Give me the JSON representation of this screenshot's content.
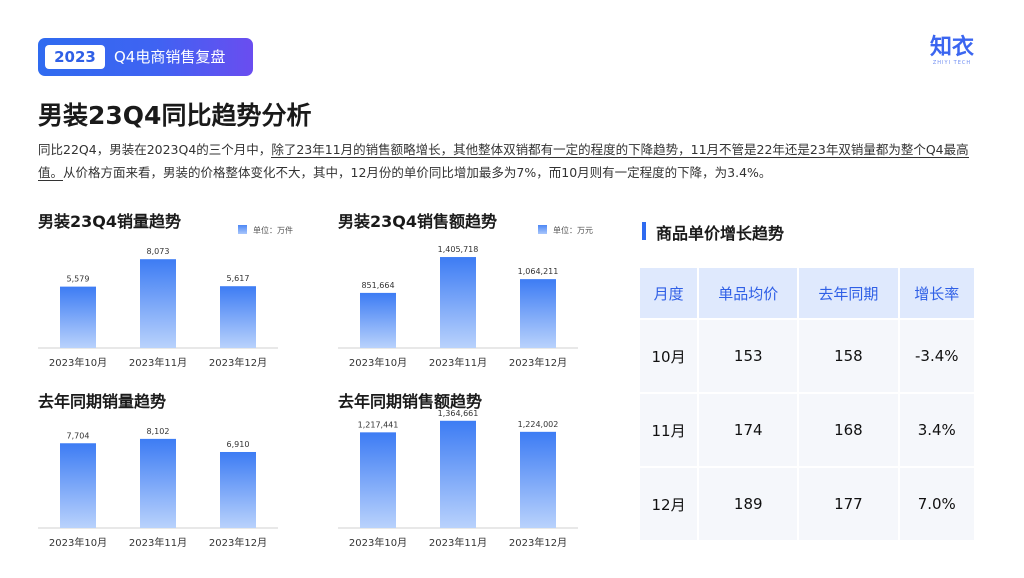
{
  "header": {
    "year": "2023",
    "title": "Q4电商销售复盘"
  },
  "logo": {
    "text": "知衣",
    "sub": "ZHIYI TECH"
  },
  "page_title": "男装23Q4同比趋势分析",
  "description": {
    "part1": "同比22Q4，男装在2023Q4的三个月中，",
    "part2": "除了23年11月的销售额略增长，其他整体双销都有一定的程度的下降趋势，11月不管是22年还是23年双销量都为整个Q4最高值。",
    "part3": "从价格方面来看，男装的价格整体变化不大，其中，12月份的单价同比增加最多为7%，而10月则有一定程度的下降，为3.4%。"
  },
  "chart_data": [
    {
      "type": "bar",
      "title": "男装23Q4销量趋势",
      "legend": "单位：万件",
      "categories": [
        "2023年10月",
        "2023年11月",
        "2023年12月"
      ],
      "values": [
        5579,
        8073,
        5617
      ],
      "value_labels": [
        "5,579",
        "8,073",
        "5,617"
      ],
      "ylim": [
        0,
        10000
      ]
    },
    {
      "type": "bar",
      "title": "男装23Q4销售额趋势",
      "legend": "单位：万元",
      "categories": [
        "2023年10月",
        "2023年11月",
        "2023年12月"
      ],
      "values": [
        851664,
        1405718,
        1064211
      ],
      "value_labels": [
        "851,664",
        "1,405,718",
        "1,064,211"
      ],
      "ylim": [
        0,
        1700000
      ]
    },
    {
      "type": "bar",
      "title": "去年同期销量趋势",
      "legend": "",
      "categories": [
        "2023年10月",
        "2023年11月",
        "2023年12月"
      ],
      "values": [
        7704,
        8102,
        6910
      ],
      "value_labels": [
        "7,704",
        "8,102",
        "6,910"
      ],
      "ylim": [
        0,
        10000
      ]
    },
    {
      "type": "bar",
      "title": "去年同期销售额趋势",
      "legend": "",
      "categories": [
        "2023年10月",
        "2023年11月",
        "2023年12月"
      ],
      "values": [
        1217441,
        1364661,
        1224002
      ],
      "value_labels": [
        "1,217,441",
        "1,364,661",
        "1,224,002"
      ],
      "ylim": [
        0,
        1400000
      ]
    }
  ],
  "price_table": {
    "title": "商品单价增长趋势",
    "headers": [
      "月度",
      "单品均价",
      "去年同期",
      "增长率"
    ],
    "rows": [
      [
        "10月",
        "153",
        "158",
        "-3.4%"
      ],
      [
        "11月",
        "174",
        "168",
        "3.4%"
      ],
      [
        "12月",
        "189",
        "177",
        "7.0%"
      ]
    ]
  },
  "colors": {
    "accent": "#2f6bf0",
    "bar_top": "#3d7cf4",
    "bar_bottom": "#b9d2fc",
    "table_header": "#dfe9fd"
  }
}
